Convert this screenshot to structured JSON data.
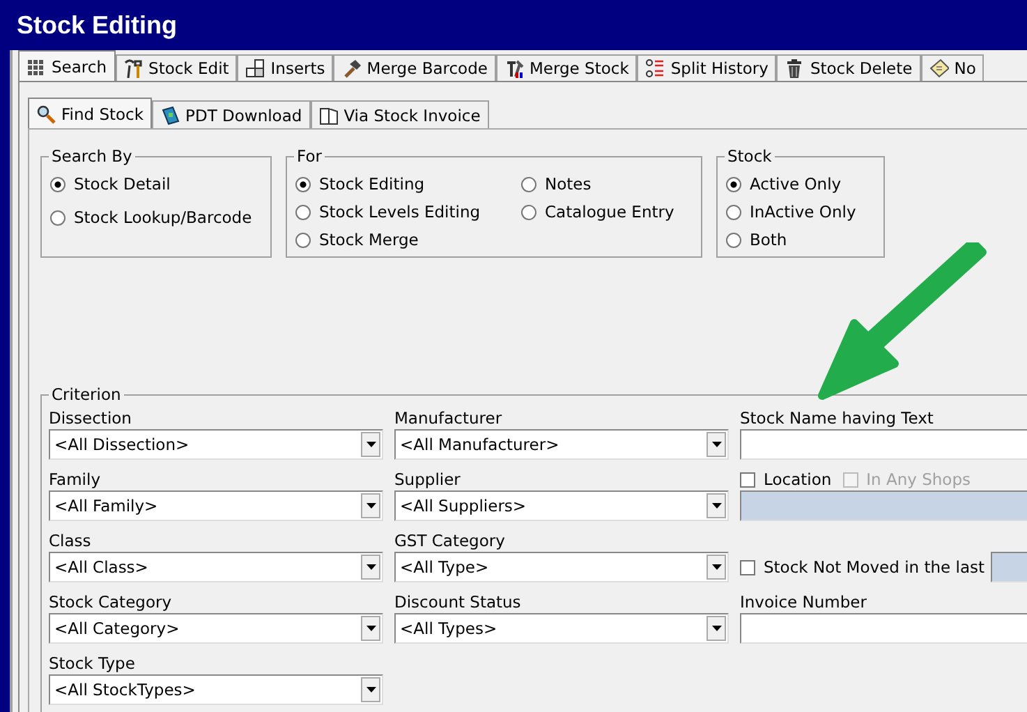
{
  "window": {
    "title": "Stock Editing"
  },
  "tabs": [
    {
      "label": "Search",
      "selected": true
    },
    {
      "label": "Stock Edit",
      "selected": false
    },
    {
      "label": "Inserts",
      "selected": false
    },
    {
      "label": "Merge Barcode",
      "selected": false
    },
    {
      "label": "Merge Stock",
      "selected": false
    },
    {
      "label": "Split History",
      "selected": false
    },
    {
      "label": "Stock Delete",
      "selected": false
    },
    {
      "label": "No",
      "selected": false
    }
  ],
  "subtabs": [
    {
      "label": "Find Stock",
      "selected": true
    },
    {
      "label": "PDT Download",
      "selected": false
    },
    {
      "label": "Via Stock Invoice",
      "selected": false
    }
  ],
  "groups": [
    {
      "title": "Search By",
      "options": [
        {
          "label": "Stock Detail",
          "selected": true
        },
        {
          "label": "Stock Lookup/Barcode",
          "selected": false
        }
      ]
    },
    {
      "title": "For",
      "options": [
        {
          "label": "Stock Editing",
          "selected": true
        },
        {
          "label": "Stock Levels Editing",
          "selected": false
        },
        {
          "label": "Stock Merge",
          "selected": false
        },
        {
          "label": "Notes",
          "selected": false
        },
        {
          "label": "Catalogue Entry",
          "selected": false
        }
      ]
    },
    {
      "title": "Stock",
      "options": [
        {
          "label": "Active Only",
          "selected": true
        },
        {
          "label": "InActive Only",
          "selected": false
        },
        {
          "label": "Both",
          "selected": false
        }
      ]
    }
  ],
  "criterion": {
    "title": "Criterion",
    "columns": [
      [
        {
          "kind": "dropdown",
          "label": "Dissection",
          "value": "<All Dissection>"
        },
        {
          "kind": "dropdown",
          "label": "Family",
          "value": "<All Family>"
        },
        {
          "kind": "dropdown",
          "label": "Class",
          "value": "<All Class>"
        },
        {
          "kind": "dropdown",
          "label": "Stock Category",
          "value": "<All Category>"
        },
        {
          "kind": "dropdown",
          "label": "Stock Type",
          "value": "<All StockTypes>"
        }
      ],
      [
        {
          "kind": "dropdown",
          "label": "Manufacturer",
          "value": "<All Manufacturer>"
        },
        {
          "kind": "dropdown",
          "label": "Supplier",
          "value": "<All Suppliers>"
        },
        {
          "kind": "dropdown",
          "label": "GST Category",
          "value": "<All Type>"
        },
        {
          "kind": "dropdown",
          "label": "Discount Status",
          "value": "<All Types>"
        }
      ],
      [
        {
          "kind": "text",
          "label": "Stock Name having Text",
          "disabled": false
        },
        {
          "kind": "checks",
          "checks": [
            {
              "label": "Location",
              "checked": false,
              "disabled": false
            },
            {
              "label": "In Any Shops",
              "checked": false,
              "disabled": true
            }
          ],
          "disabled": true
        },
        {
          "kind": "inline_check",
          "label": "Stock Not Moved in the last",
          "checked": false,
          "field_disabled": true
        },
        {
          "kind": "text",
          "label": "Invoice Number",
          "disabled": false
        }
      ]
    ]
  }
}
